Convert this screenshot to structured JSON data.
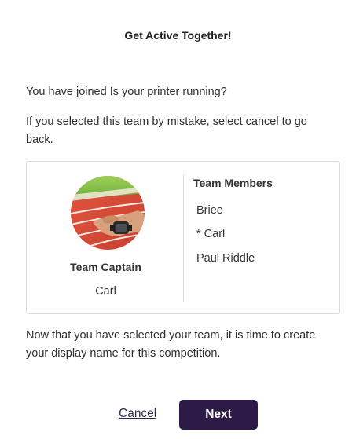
{
  "dialog": {
    "title": "Get Active Together!",
    "joined_text": "You have joined Is your printer running?",
    "mistake_text": "If you selected this team by mistake, select cancel to go back.",
    "display_name_text": "Now that you have selected your team, it is time to create your display name for this competition."
  },
  "team_card": {
    "captain_label": "Team Captain",
    "captain_name": "Carl",
    "members_title": "Team Members",
    "members": [
      "Briee",
      "* Carl",
      "Paul Riddle"
    ],
    "avatar_icon": "team-photo-running-track-smartwatch"
  },
  "actions": {
    "cancel_label": "Cancel",
    "next_label": "Next"
  },
  "colors": {
    "primary_button": "#2e1a47",
    "link": "#3a2a4e",
    "border": "#dcdcdc"
  }
}
